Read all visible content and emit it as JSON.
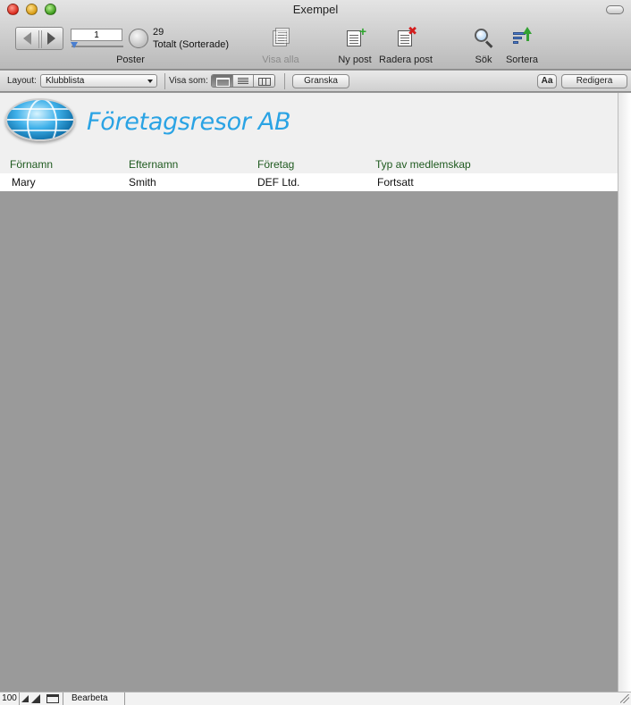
{
  "window": {
    "title": "Exempel"
  },
  "toolbar": {
    "record_number": "1",
    "record_count": "29",
    "sort_status": "Totalt (Sorterade)",
    "records_label": "Poster",
    "show_all_label": "Visa alla",
    "new_record_label": "Ny post",
    "delete_record_label": "Radera post",
    "find_label": "Sök",
    "sort_label": "Sortera"
  },
  "layout_bar": {
    "layout_label": "Layout:",
    "layout_value": "Klubblista",
    "view_as_label": "Visa som:",
    "view_modes": [
      "form",
      "list",
      "table"
    ],
    "view_mode_selected": "form",
    "preview_label": "Granska",
    "text_format_label": "Aa",
    "edit_label": "Redigera"
  },
  "header": {
    "company_name": "Företagsresor AB"
  },
  "columns": [
    "Förnamn",
    "Efternamn",
    "Företag",
    "Typ av medlemskap"
  ],
  "records": [
    {
      "first_name": "Mary",
      "last_name": "Smith",
      "company": "DEF Ltd.",
      "membership": "Fortsatt"
    }
  ],
  "status_bar": {
    "zoom": "100",
    "mode": "Bearbeta"
  },
  "colors": {
    "company_name": "#2aa3e4",
    "column_header": "#1f5a1f",
    "content_background": "#9a9a9a"
  }
}
